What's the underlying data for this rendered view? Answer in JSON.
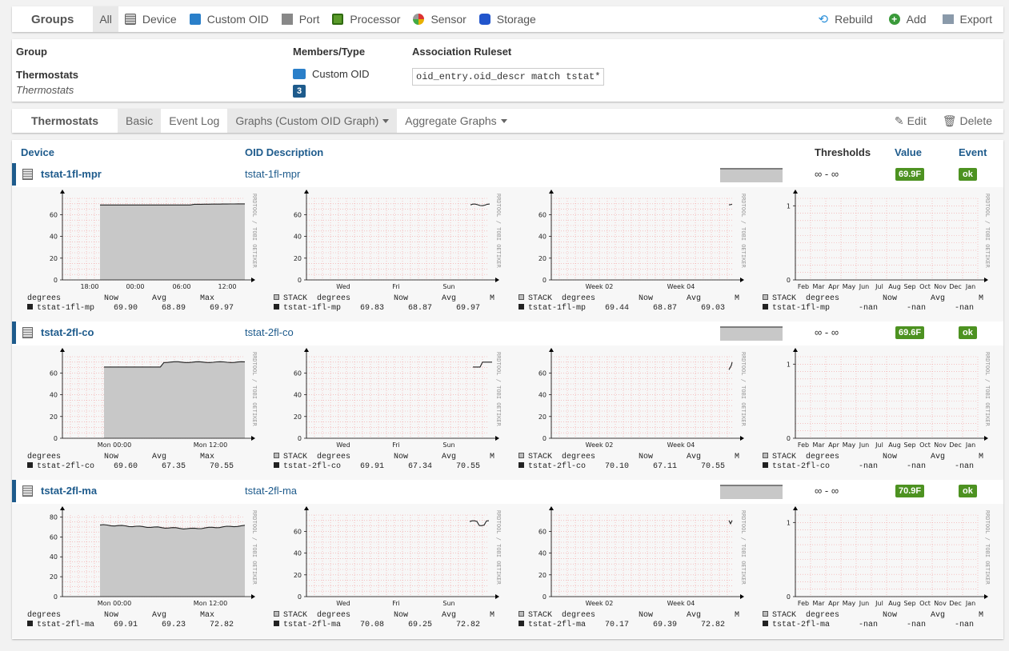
{
  "nav": {
    "brand": "Groups",
    "items": [
      {
        "label": "All",
        "icon": "none",
        "active": true
      },
      {
        "label": "Device",
        "icon": "server-icon"
      },
      {
        "label": "Custom OID",
        "icon": "folder-icon"
      },
      {
        "label": "Port",
        "icon": "network-port-icon"
      },
      {
        "label": "Processor",
        "icon": "chip-icon"
      },
      {
        "label": "Sensor",
        "icon": "gauge-icon"
      },
      {
        "label": "Storage",
        "icon": "database-icon"
      }
    ],
    "right": [
      {
        "label": "Rebuild",
        "icon": "rebuild-icon"
      },
      {
        "label": "Add",
        "icon": "add-icon"
      },
      {
        "label": "Export",
        "icon": "export-icon"
      }
    ]
  },
  "group": {
    "headers": {
      "group": "Group",
      "members": "Members/Type",
      "ruleset": "Association Ruleset"
    },
    "name": "Thermostats",
    "description": "Thermostats",
    "member_type": "Custom OID",
    "member_count": "3",
    "ruleset": "oid_entry.oid_descr match tstat*"
  },
  "subnav": {
    "brand": "Thermostats",
    "tabs": [
      {
        "label": "Basic",
        "active": true
      },
      {
        "label": "Event Log"
      },
      {
        "label": "Graphs (Custom OID Graph)",
        "dropdown": true,
        "active": true
      },
      {
        "label": "Aggregate Graphs",
        "dropdown": true
      }
    ],
    "edit": "Edit",
    "delete": "Delete"
  },
  "table": {
    "headers": {
      "device": "Device",
      "oid": "OID Description",
      "thresholds": "Thresholds",
      "value": "Value",
      "event": "Event"
    }
  },
  "graph_labels": {
    "watermark": "RRDTOOL / TOBI OETIKER",
    "x_day_1": [
      "18:00",
      "00:00",
      "06:00",
      "12:00"
    ],
    "x_day_2": [
      "Mon 00:00",
      "Mon 12:00"
    ],
    "x_week": [
      "Wed",
      "Fri",
      "Sun"
    ],
    "x_month": [
      "Week 02",
      "Week 04"
    ],
    "x_year": [
      "Feb",
      "Mar",
      "Apr",
      "May",
      "Jun",
      "Jul",
      "Aug",
      "Sep",
      "Oct",
      "Nov",
      "Dec",
      "Jan"
    ],
    "y_temp": [
      "0",
      "20",
      "40",
      "60"
    ],
    "y_temp_80": [
      "0",
      "20",
      "40",
      "60",
      "80"
    ],
    "y_year": [
      "0",
      "1"
    ],
    "legend_head_1": "degrees         Now       Avg       Max",
    "legend_head_stack": "STACK  degrees         Now       Avg       M"
  },
  "devices": [
    {
      "name": "tstat-1fl-mpr",
      "oid": "tstat-1fl-mpr",
      "thresholds": "∞ - ∞",
      "value": "69.9F",
      "event": "ok",
      "legend": [
        "tstat-1fl-mp    69.90     68.89     69.97",
        "tstat-1fl-mp    69.83     68.87     69.97",
        "tstat-1fl-mp    69.44     68.87     69.03",
        "tstat-1fl-mp      -nan      -nan      -nan"
      ]
    },
    {
      "name": "tstat-2fl-co",
      "oid": "tstat-2fl-co",
      "thresholds": "∞ - ∞",
      "value": "69.6F",
      "event": "ok",
      "legend": [
        "tstat-2fl-co    69.60     67.35     70.55",
        "tstat-2fl-co    69.91     67.34     70.55",
        "tstat-2fl-co    70.10     67.11     70.55",
        "tstat-2fl-co      -nan      -nan      -nan"
      ]
    },
    {
      "name": "tstat-2fl-ma",
      "oid": "tstat-2fl-ma",
      "thresholds": "∞ - ∞",
      "value": "70.9F",
      "event": "ok",
      "legend": [
        "tstat-2fl-ma    69.91     69.23     72.82",
        "tstat-2fl-ma    70.08     69.25     72.82",
        "tstat-2fl-ma    70.17     69.39     72.82",
        "tstat-2fl-ma      -nan      -nan      -nan"
      ]
    }
  ],
  "colors": {
    "accent": "#1e5b8c",
    "ok": "#4d9221",
    "grid": "#f4a0a0",
    "area": "#c8c8c8"
  }
}
